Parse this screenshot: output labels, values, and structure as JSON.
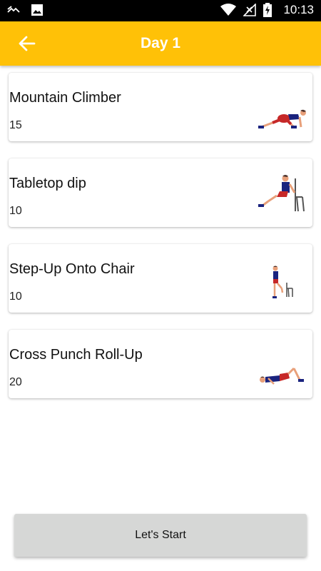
{
  "status_bar": {
    "time": "10:13",
    "icons": [
      "link-icon",
      "image-icon",
      "wifi-icon",
      "no-signal-icon",
      "battery-charging-icon"
    ]
  },
  "header": {
    "title": "Day 1",
    "back_icon": "arrow-left-icon",
    "background": "#FFC107"
  },
  "exercises": [
    {
      "name": "Mountain Climber",
      "count": "15",
      "image": "mountain-climber-figure"
    },
    {
      "name": "Tabletop dip",
      "count": "10",
      "image": "tabletop-dip-figure"
    },
    {
      "name": "Step-Up Onto Chair",
      "count": "10",
      "image": "step-up-figure"
    },
    {
      "name": "Cross Punch Roll-Up",
      "count": "20",
      "image": "cross-punch-rollup-figure"
    }
  ],
  "footer": {
    "start_label": "Let's Start"
  }
}
